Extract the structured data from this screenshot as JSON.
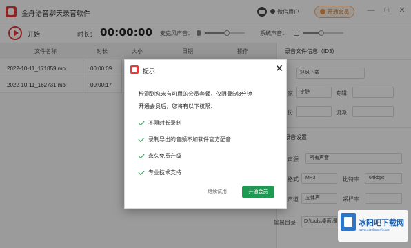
{
  "app": {
    "title": "金舟语音聊天录音软件",
    "user_label": "微信用户",
    "vip_button": "开通会员",
    "minimize": "—",
    "maximize": "□",
    "close": "✕"
  },
  "toolbar": {
    "start_label": "开始",
    "duration_label": "时长：",
    "timer": "00:00:00",
    "mic_label": "麦克风声音：",
    "mic_level": 0.55,
    "sys_label": "系统声音：",
    "sys_level": 0.45
  },
  "table": {
    "headers": [
      "文件名称",
      "时长",
      "大小",
      "日期",
      "操作"
    ],
    "rows": [
      {
        "name": "2022-10-11_171859.mp:",
        "duration": "00:00:09"
      },
      {
        "name": "2022-10-11_162731.mp:",
        "duration": "00:00:17"
      }
    ]
  },
  "right_panel": {
    "section1": "录音文件信息（ID3）",
    "title_value": "轻风下载",
    "artist_label": "家",
    "artist_value": "李静",
    "album_label": "专辑",
    "year_label": "份",
    "genre_label": "流派",
    "section2": "录音设置",
    "source_label": "声源",
    "source_value": "所有声音",
    "format_label": "格式",
    "format_value": "MP3",
    "bitrate_label": "比特率",
    "bitrate_value": "64kbps",
    "channel_label": "声道",
    "channel_value": "立体声",
    "sample_label": "采样率",
    "output_label": "输出目录",
    "output_path": "D:\\tools\\桌面\\录音"
  },
  "dialog": {
    "title": "提示",
    "close_glyph": "✕",
    "message1": "检测到您未有可用的会员套餐，仅限录制3分钟",
    "message2": "开通会员后，您将有以下权限：",
    "features": [
      "不限时长录制",
      "录制导出的音频不加软件官方配音",
      "永久免费升级",
      "专业技术支持"
    ],
    "later_button": "继续试用",
    "open_button": "开通会员"
  },
  "watermark": {
    "text": "冰阳吧下载网",
    "sub": "www.xiaobasoft.com"
  },
  "colors": {
    "brand_red": "#e23b3b",
    "vip_orange": "#e9b27a",
    "green_button": "#1e9a52",
    "check_green": "#2b9a55"
  }
}
